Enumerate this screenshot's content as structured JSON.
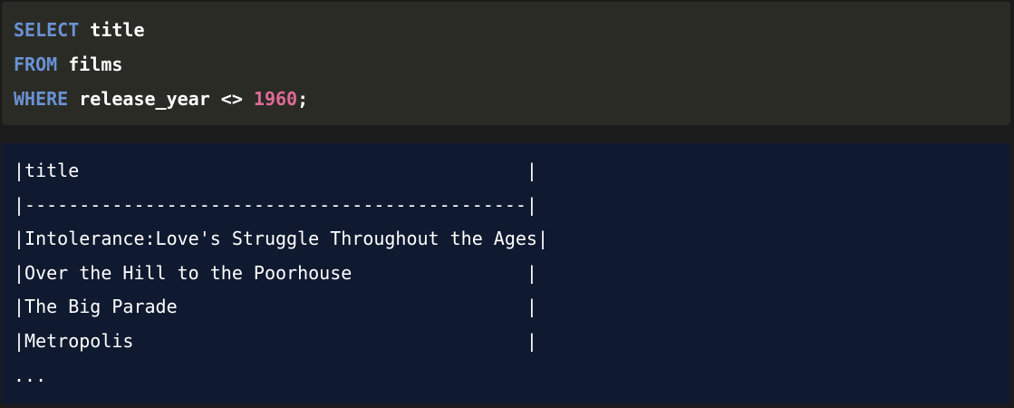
{
  "code": {
    "lines": [
      {
        "keyword": "SELECT",
        "rest": " title",
        "number": "",
        "tail": ""
      },
      {
        "keyword": "FROM",
        "rest": " films",
        "number": "",
        "tail": ""
      },
      {
        "keyword": "WHERE",
        "rest": " release_year <> ",
        "number": "1960",
        "tail": ";"
      }
    ]
  },
  "result": {
    "lines": [
      "|title                                         |",
      "|----------------------------------------------|",
      "|Intolerance:Love's Struggle Throughout the Ages|",
      "|Over the Hill to the Poorhouse                |",
      "|The Big Parade                                |",
      "|Metropolis                                    |",
      "..."
    ]
  },
  "colors": {
    "keyword": "#6a92d4",
    "number": "#e06a97",
    "code_bg": "#2b2b25",
    "result_bg": "#0f1a30"
  }
}
